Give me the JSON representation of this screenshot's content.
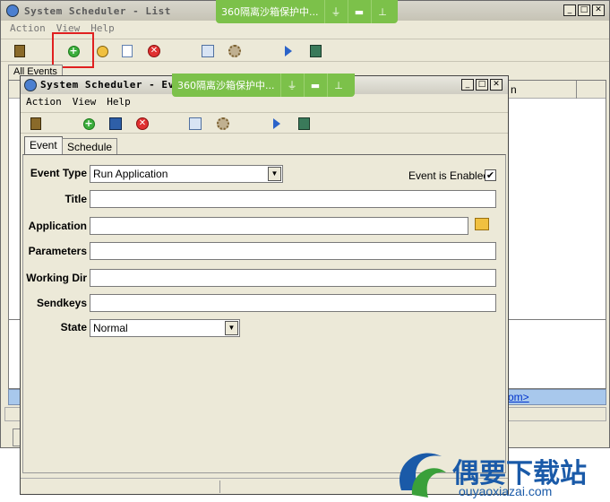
{
  "back_window": {
    "title": "System Scheduler - List",
    "menu": [
      "Action",
      "View",
      "Help"
    ],
    "tab_label": "All Events",
    "column_fragment": "n",
    "link_fragment": "om>"
  },
  "front_window": {
    "title": "System Scheduler - Eve",
    "menu": [
      "Action",
      "View",
      "Help"
    ],
    "tabs": [
      "Event",
      "Schedule"
    ],
    "fields": {
      "event_type_label": "Event Type",
      "event_type_value": "Run Application",
      "event_enabled_label": "Event is Enabled",
      "event_enabled_checked": true,
      "title_label": "Title",
      "application_label": "Application",
      "parameters_label": "Parameters",
      "working_dir_label": "Working Dir",
      "sendkeys_label": "Sendkeys",
      "state_label": "State",
      "state_value": "Normal"
    }
  },
  "sandbox_banner": {
    "text": "360隔离沙箱保护中..."
  },
  "watermark": {
    "cn": "偶要下载站",
    "en": "ouyaoxiazai.com"
  },
  "colors": {
    "highlight": "#e02020",
    "banner": "#7cc14a",
    "watermark_blue": "#1a5aa8"
  }
}
